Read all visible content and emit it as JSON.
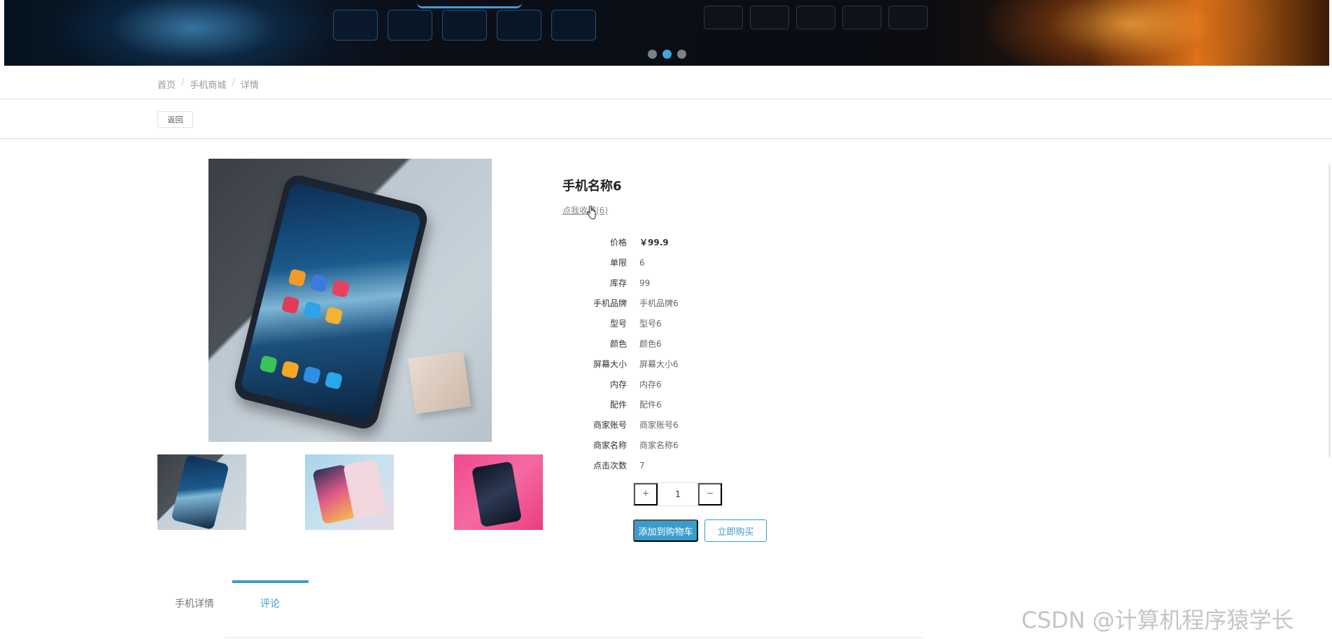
{
  "carousel": {
    "slide_count": 3,
    "active_index": 1
  },
  "breadcrumb": {
    "items": [
      "首页",
      "手机商城",
      "详情"
    ],
    "separator": "/"
  },
  "toolbar": {
    "back_label": "返回"
  },
  "product": {
    "name": "手机名称6",
    "favorite_label": "点我收藏(6)",
    "specs": [
      {
        "label": "价格",
        "value": "￥99.9"
      },
      {
        "label": "单限",
        "value": "6"
      },
      {
        "label": "库存",
        "value": "99"
      },
      {
        "label": "手机品牌",
        "value": "手机品牌6"
      },
      {
        "label": "型号",
        "value": "型号6"
      },
      {
        "label": "颜色",
        "value": "颜色6"
      },
      {
        "label": "屏幕大小",
        "value": "屏幕大小6"
      },
      {
        "label": "内存",
        "value": "内存6"
      },
      {
        "label": "配件",
        "value": "配件6"
      },
      {
        "label": "商家账号",
        "value": "商家账号6"
      },
      {
        "label": "商家名称",
        "value": "商家名称6"
      },
      {
        "label": "点击次数",
        "value": "7"
      }
    ]
  },
  "quantity": {
    "plus": "+",
    "value": "1",
    "minus": "−"
  },
  "actions": {
    "add_to_cart": "添加到购物车",
    "buy_now": "立即购买"
  },
  "tabs": [
    {
      "label": "手机详情",
      "active": false
    },
    {
      "label": "评论",
      "active": true
    }
  ],
  "watermark": "CSDN @计算机程序猿学长",
  "colors": {
    "accent": "#3a9ccd",
    "dot_active": "#43a3d9"
  }
}
